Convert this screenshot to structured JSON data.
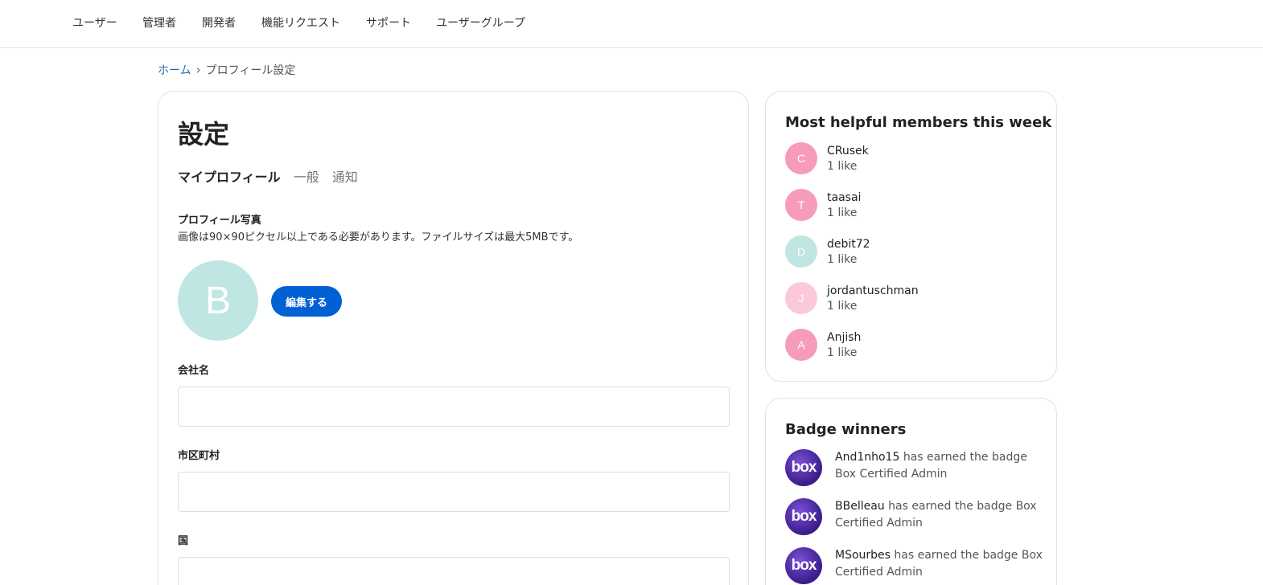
{
  "nav": {
    "items": [
      "ユーザー",
      "管理者",
      "開発者",
      "機能リクエスト",
      "サポート",
      "ユーザーグループ"
    ]
  },
  "breadcrumb": {
    "home": "ホーム",
    "separator": "›",
    "current": "プロフィール設定"
  },
  "settings": {
    "title": "設定",
    "tabs": [
      "マイプロフィール",
      "一般",
      "通知"
    ],
    "photo_label": "プロフィール写真",
    "photo_help": "画像は90×90ピクセル以上である必要があります。ファイルサイズは最大5MBです。",
    "avatar_letter": "B",
    "edit_button": "編集する",
    "fields": [
      {
        "label": "会社名",
        "value": ""
      },
      {
        "label": "市区町村",
        "value": ""
      },
      {
        "label": "国",
        "value": ""
      }
    ]
  },
  "helpful": {
    "title": "Most helpful members this week",
    "members": [
      {
        "initial": "C",
        "name": "CRusek",
        "likes": "1 like",
        "color": "#f79bbb"
      },
      {
        "initial": "T",
        "name": "taasai",
        "likes": "1 like",
        "color": "#f79bbb"
      },
      {
        "initial": "D",
        "name": "debit72",
        "likes": "1 like",
        "color": "#bfe6e2"
      },
      {
        "initial": "J",
        "name": "jordantuschman",
        "likes": "1 like",
        "color": "#fbc9da"
      },
      {
        "initial": "A",
        "name": "Anjish",
        "likes": "1 like",
        "color": "#f79bbb"
      }
    ]
  },
  "badges": {
    "title": "Badge winners",
    "icon_text": "box",
    "winners": [
      {
        "user": "And1nho15",
        "text": " has earned the badge Box Certified Admin"
      },
      {
        "user": "BBelleau",
        "text": " has earned the badge Box Certified Admin"
      },
      {
        "user": "MSourbes",
        "text": " has earned the badge Box Certified Admin"
      }
    ]
  }
}
